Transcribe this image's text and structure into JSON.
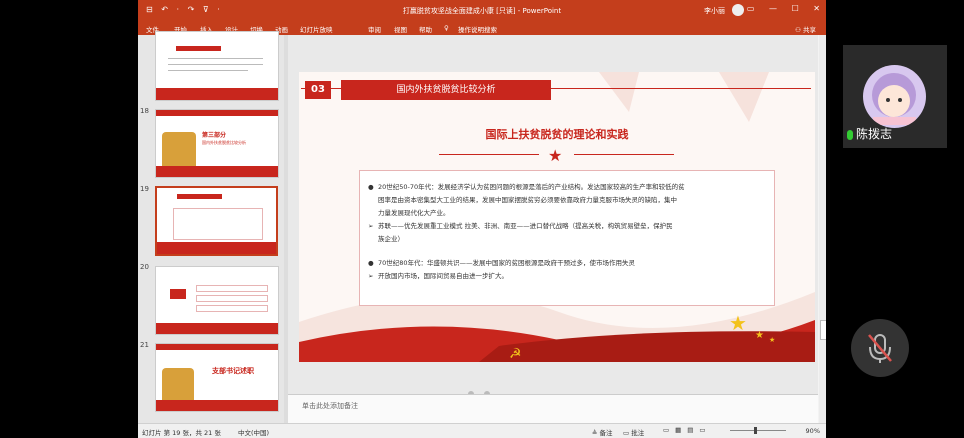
{
  "window": {
    "title": "打赢脱贫攻坚战全面建成小康 [只读]  -  PowerPoint",
    "user_name": "李小丽",
    "quick_access": "⊟ ↶ · ↷ ⊽ ·",
    "window_controls": [
      "▭",
      "—",
      "☐",
      "✕"
    ]
  },
  "ribbon": {
    "tabs": [
      "文件",
      "开始",
      "插入",
      "设计",
      "切换",
      "动画",
      "幻灯片放映",
      "审阅",
      "视图",
      "帮助",
      "操作说明搜索"
    ],
    "share": "共享"
  },
  "thumbnails": {
    "numbers": [
      "18",
      "19",
      "20",
      "21"
    ],
    "slide18_title": "第三部分",
    "slide18_sub": "国内外扶贫脱贫比较分析",
    "slide21_title": "支部书记述职"
  },
  "slide": {
    "section_number": "03",
    "section_title": "国内外扶贫脱贫比较分析",
    "title": "国际上扶贫脱贫的理论和实践",
    "bullets": [
      {
        "mark": "●",
        "text": "20世纪50-70年代：发展经济学认为贫困问题的根源是落后的产业结构。发达国家较高的生产率和较低的贫"
      },
      {
        "mark": "",
        "text": "困率是由资本密集型大工业的结果，发展中国家摆脱贫穷必须要依靠政府力量克服市场失灵的缺陷，集中"
      },
      {
        "mark": "",
        "text": "力量发展现代化大产业。"
      },
      {
        "mark": "➢",
        "text": "苏联——优先发展重工业模式     拉美、非洲、南亚——进口替代战略（提高关税，构筑贸易壁垒，保护民"
      },
      {
        "mark": "",
        "text": "族企业）"
      },
      {
        "mark": "●",
        "text": "70世纪80年代：华盛顿共识——发展中国家的贫困根源是政府干预过多，使市场作用失灵"
      },
      {
        "mark": "➢",
        "text": "开放国内市场，国际间贸易自由进一步扩大。"
      }
    ]
  },
  "notes_placeholder": "单击此处添加备注",
  "status": {
    "slide_info": "幻灯片 第 19 张，共 21 张",
    "language": "中文(中国)",
    "notes": "≜ 备注",
    "comments": "▭ 批注",
    "zoom": "90%"
  },
  "video_panel": {
    "name": "陈拨志",
    "avatar_caption": "小彤 熊猫"
  },
  "colors": {
    "brand": "#c43e1c",
    "slide_red": "#c8261d"
  }
}
